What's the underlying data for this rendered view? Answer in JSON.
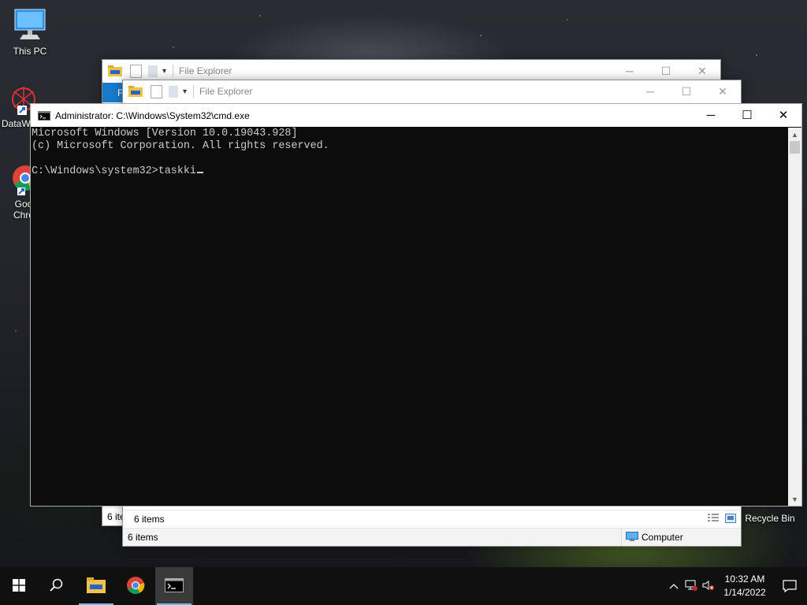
{
  "desktop": {
    "icons": [
      {
        "label": "This PC"
      },
      {
        "label": "DataW"
      },
      {
        "label": "Goo\nChro"
      },
      {
        "label": "Recycle Bin"
      }
    ]
  },
  "explorer_back": {
    "title": "File Explorer",
    "status_items": "6 ite",
    "ribbon_tab_fragment": "F"
  },
  "explorer_front": {
    "title": "File Explorer",
    "status_items": "6 items",
    "details_items": "6 items",
    "location": "Computer"
  },
  "cmd": {
    "title": "Administrator: C:\\Windows\\System32\\cmd.exe",
    "lines": [
      "Microsoft Windows [Version 10.0.19043.928]",
      "(c) Microsoft Corporation. All rights reserved.",
      "",
      "C:\\Windows\\system32>taskki"
    ]
  },
  "taskbar": {
    "time": "10:32 AM",
    "date": "1/14/2022"
  },
  "colors": {
    "taskbar": "#101010",
    "console_bg": "#0c0c0c",
    "console_fg": "#cccccc",
    "accent": "#0078d7"
  }
}
